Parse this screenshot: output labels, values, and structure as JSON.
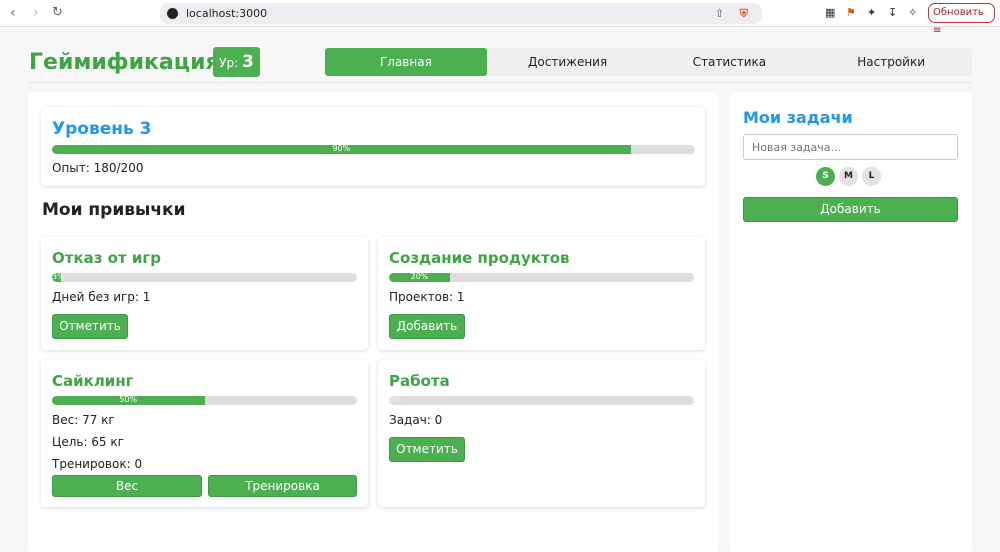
{
  "browser": {
    "url": "localhost:3000",
    "update_label": "Обновить"
  },
  "header": {
    "title": "Геймификация",
    "level_prefix": "Ур:",
    "level": "3",
    "tabs": [
      "Главная",
      "Достижения",
      "Статистика",
      "Настройки"
    ]
  },
  "level_card": {
    "title": "Уровень 3",
    "progress_percent": 90,
    "progress_label": "90%",
    "xp": "Опыт: 180/200"
  },
  "habits_title": "Мои привычки",
  "habits": [
    {
      "title": "Отказ от игр",
      "progress_percent": 3,
      "progress_label": "3%",
      "lines": [
        "Дней без игр: 1"
      ],
      "buttons": [
        "Отметить"
      ]
    },
    {
      "title": "Создание продуктов",
      "progress_percent": 20,
      "progress_label": "20%",
      "lines": [
        "Проектов: 1"
      ],
      "buttons": [
        "Добавить"
      ]
    },
    {
      "title": "Сайклинг",
      "progress_percent": 50,
      "progress_label": "50%",
      "lines": [
        "Вес: 77 кг",
        "Цель: 65 кг",
        "Тренировок: 0"
      ],
      "buttons": [
        "Вес",
        "Тренировка"
      ]
    },
    {
      "title": "Работа",
      "progress_percent": 0,
      "progress_label": "0%",
      "lines": [
        "Задач: 0"
      ],
      "buttons": [
        "Отметить"
      ]
    }
  ],
  "tasks": {
    "title": "Мои задачи",
    "placeholder": "Новая задача...",
    "sizes": [
      "S",
      "M",
      "L"
    ],
    "selected_size": "S",
    "add_label": "Добавить"
  },
  "colors": {
    "accent": "#4caf50",
    "title_blue": "#2196f3"
  }
}
